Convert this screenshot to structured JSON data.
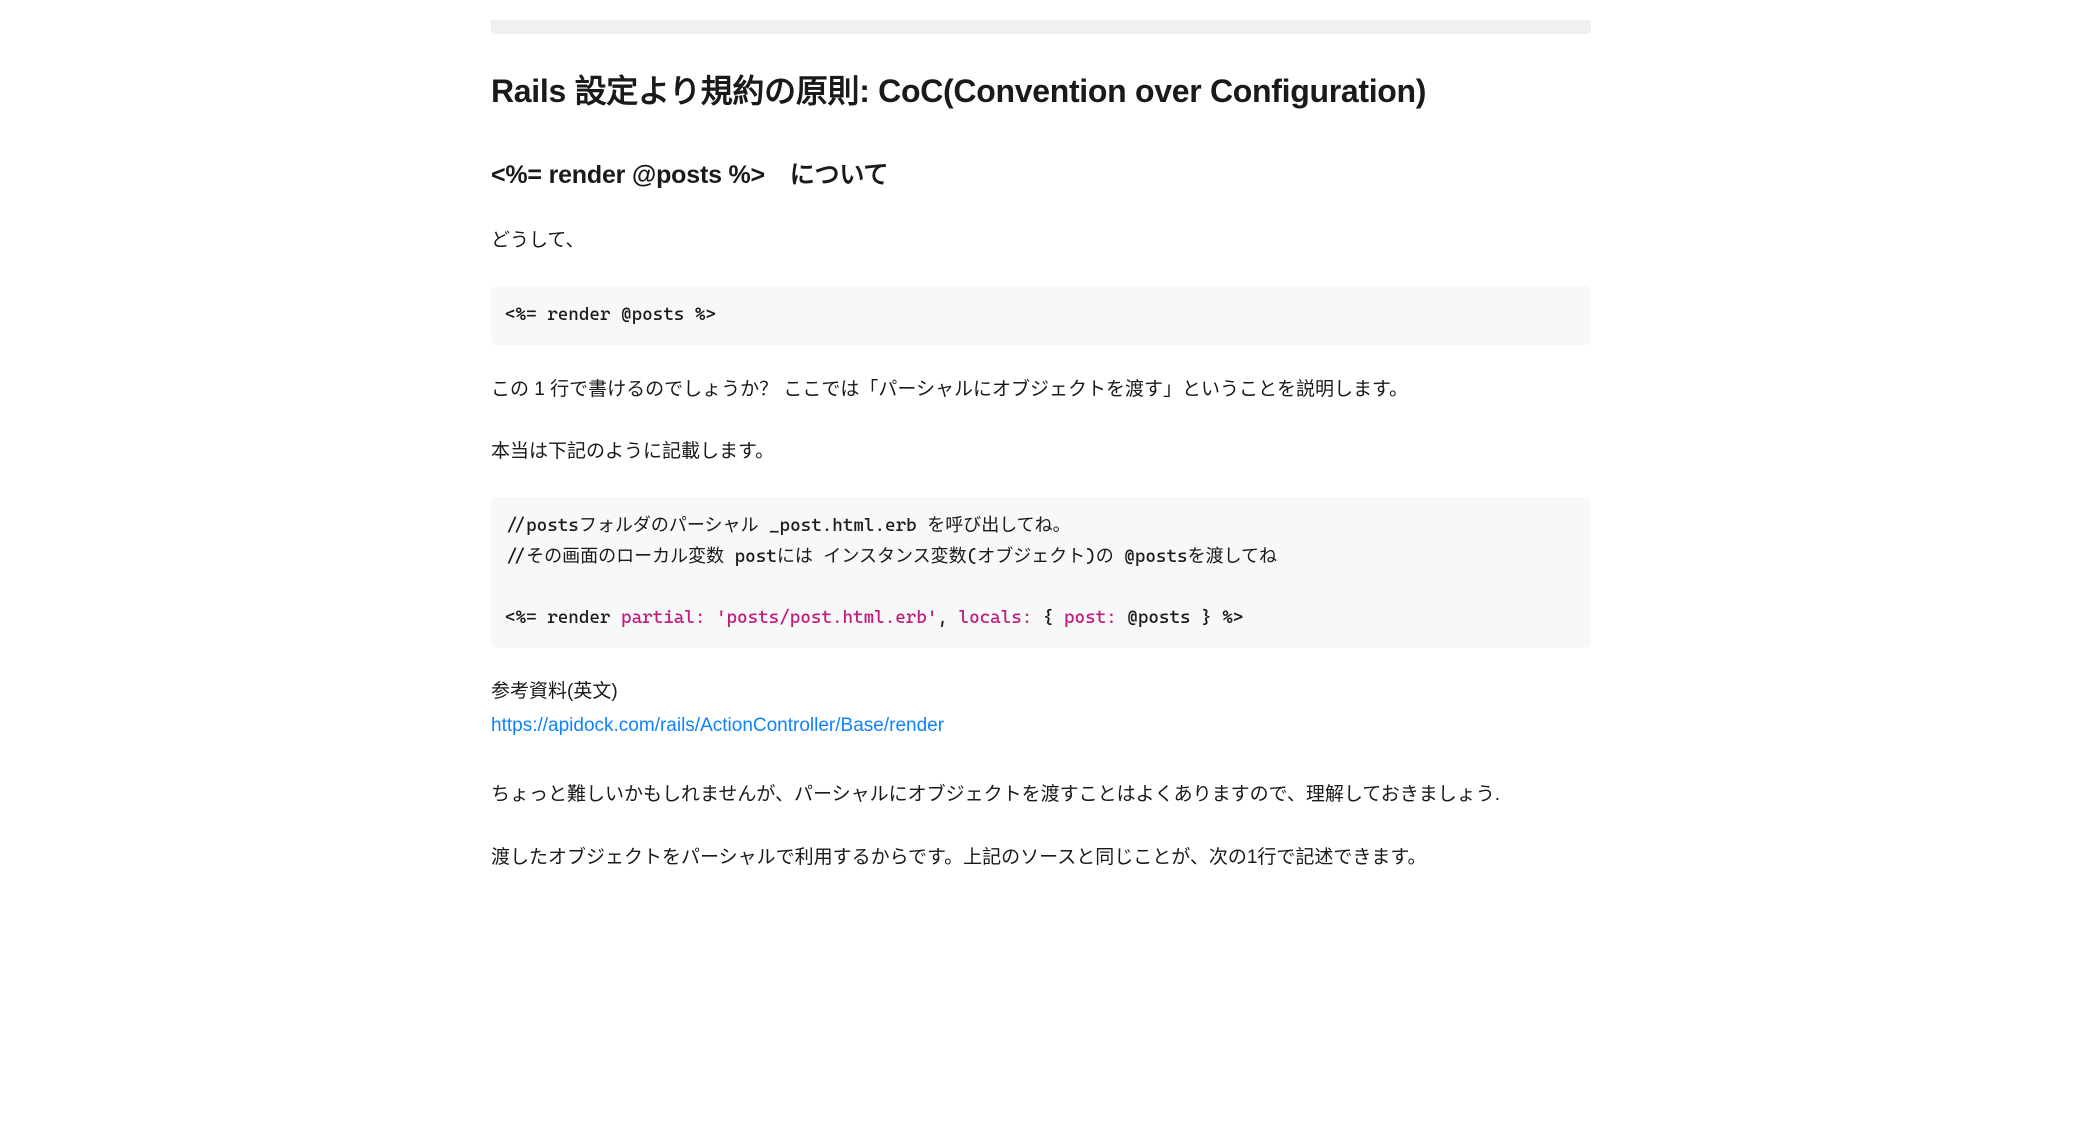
{
  "heading1": "Rails 設定より規約の原則: CoC(Convention over Configuration)",
  "heading2": "<%= render @posts %>　について",
  "p1": "どうして、",
  "code1": "<%= render @posts %>",
  "p2": "この 1 行で書けるのでしょうか？ ここでは「パーシャルにオブジェクトを渡す」ということを説明します。",
  "p3": "本当は下記のように記載します。",
  "code2": {
    "line1": "//postsフォルダのパーシャル _post.html.erb を呼び出してね。",
    "line2": "//その画面のローカル変数 postには インスタンス変数(オブジェクト)の @postsを渡してね",
    "line3_pre": "<%= render ",
    "line3_partial": "partial:",
    "line3_str": " 'posts/post.html.erb'",
    "line3_mid": ", ",
    "line3_locals": "locals:",
    "line3_brace_open": " { ",
    "line3_post": "post:",
    "line3_end": " @posts } %>"
  },
  "ref_label": "参考資料(英文)",
  "ref_link_text": "https://apidock.com/rails/ActionController/Base/render",
  "ref_link_href": "https://apidock.com/rails/ActionController/Base/render",
  "p4": "ちょっと難しいかもしれませんが、パーシャルにオブジェクトを渡すことはよくありますので、理解しておきましょう.",
  "p5": "渡したオブジェクトをパーシャルで利用するからです。上記のソースと同じことが、次の1行で記述できます。"
}
